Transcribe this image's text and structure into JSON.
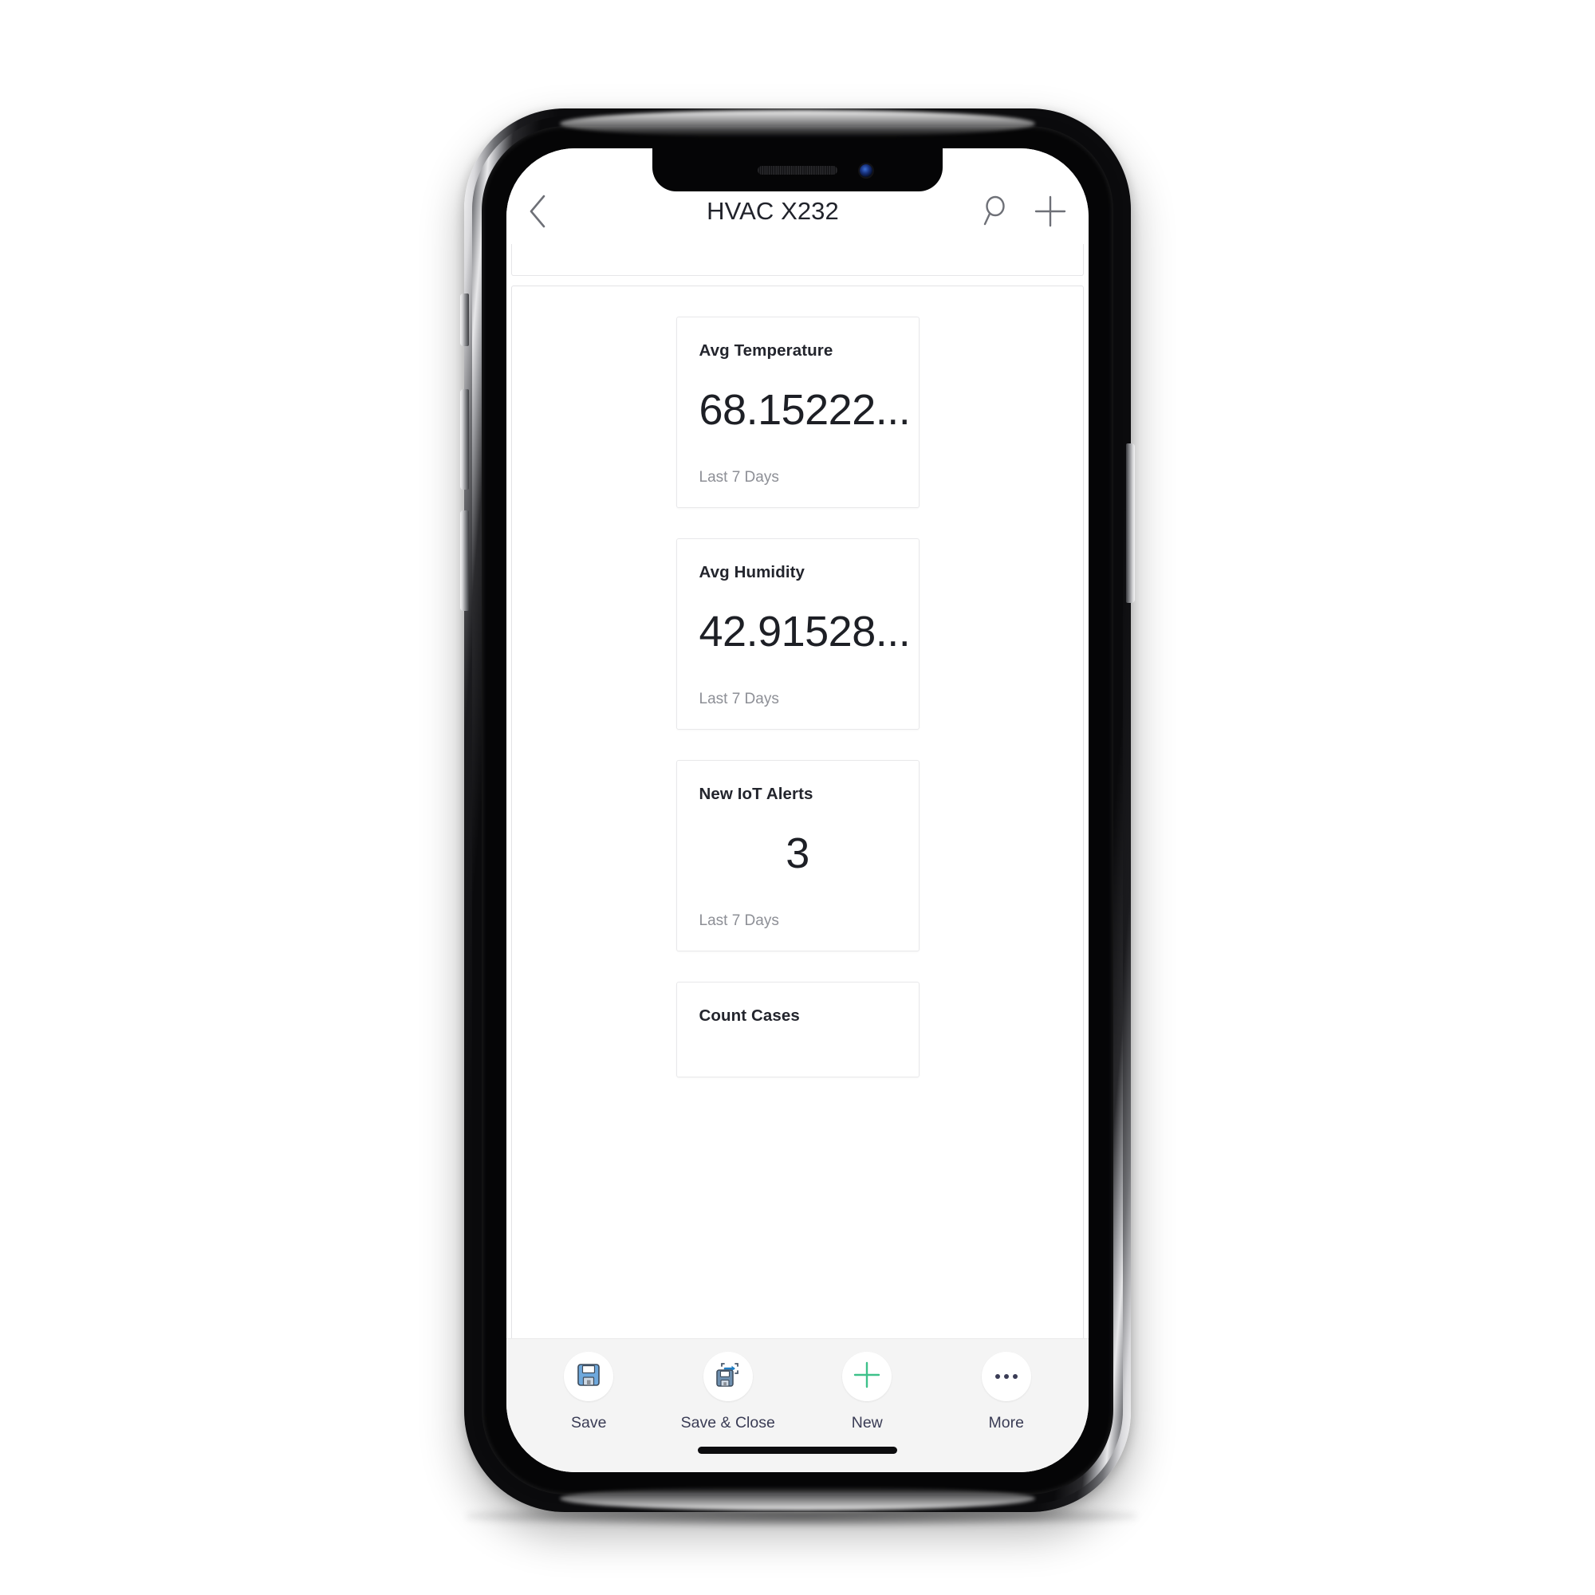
{
  "app": {
    "title": "HVAC X232"
  },
  "navbar": {
    "back_icon": "chevron-left-icon",
    "title": "HVAC X232",
    "search_icon": "search-icon",
    "add_icon": "plus-icon"
  },
  "cards": [
    {
      "title": "Avg Temperature",
      "value": "68.15222...",
      "footer": "Last 7 Days",
      "align": "left"
    },
    {
      "title": "Avg Humidity",
      "value": "42.91528...",
      "footer": "Last 7 Days",
      "align": "left"
    },
    {
      "title": "New IoT Alerts",
      "value": "3",
      "footer": "Last 7 Days",
      "align": "center"
    },
    {
      "title": "Count Cases",
      "value": "",
      "footer": "",
      "align": "left"
    }
  ],
  "commandbar": {
    "items": [
      {
        "label": "Save",
        "icon": "floppy-disk-icon"
      },
      {
        "label": "Save & Close",
        "icon": "floppy-disk-arrow-icon"
      },
      {
        "label": "New",
        "icon": "plus-icon"
      },
      {
        "label": "More",
        "icon": "ellipsis-icon"
      }
    ]
  },
  "colors": {
    "accent_green": "#3ec18a",
    "floppy_blue": "#5a9bd5",
    "label_ink": "#3a3c55",
    "title_ink": "#23252d",
    "muted_ink": "#8d8f96"
  }
}
